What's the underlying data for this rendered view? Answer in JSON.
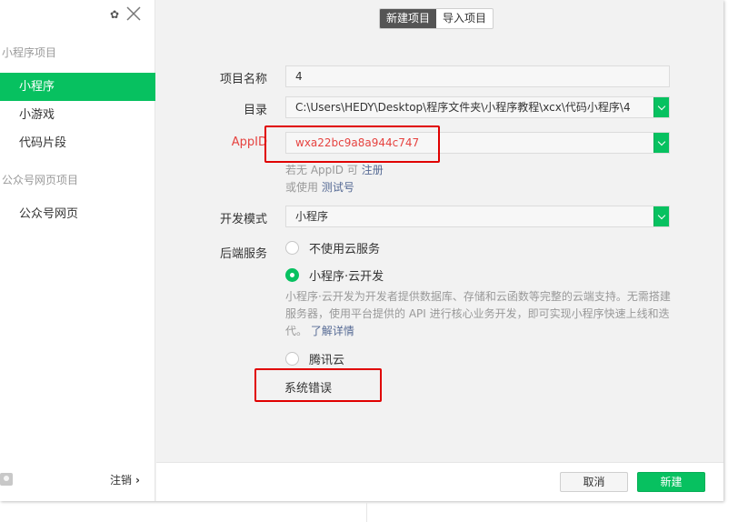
{
  "sidebar": {
    "settings_icon": "gear-icon",
    "close_icon": "close-icon",
    "section_mini": "小程序项目",
    "items_mini": [
      {
        "label": "小程序",
        "active": true
      },
      {
        "label": "小游戏",
        "active": false
      },
      {
        "label": "代码片段",
        "active": false
      }
    ],
    "section_public": "公众号网页项目",
    "items_public": [
      {
        "label": "公众号网页",
        "active": false
      }
    ],
    "logout_label": "注销",
    "logout_chevron": "›"
  },
  "tabs": [
    {
      "label": "新建项目",
      "active": true
    },
    {
      "label": "导入项目",
      "active": false
    }
  ],
  "form": {
    "name_label": "项目名称",
    "name_value": "4",
    "dir_label": "目录",
    "dir_value": "C:\\Users\\HEDY\\Desktop\\程序文件夹\\小程序教程\\xcx\\代码小程序\\4",
    "appid_label": "AppID",
    "appid_value": "wxa22bc9a8a944c747",
    "appid_hint_prefix": "若无 AppID 可",
    "appid_hint_link": "注册",
    "appid_hint2_prefix": "或使用",
    "appid_hint2_link": "测试号",
    "mode_label": "开发模式",
    "mode_value": "小程序",
    "backend_label": "后端服务",
    "backend_options": [
      {
        "label": "不使用云服务",
        "selected": false
      },
      {
        "label": "小程序·云开发",
        "selected": true
      },
      {
        "label": "腾讯云",
        "selected": false
      }
    ],
    "cloud_desc": "小程序·云开发为开发者提供数据库、存储和云函数等完整的云端支持。无需搭建服务器，使用平台提供的 API 进行核心业务开发，即可实现小程序快速上线和迭代。",
    "cloud_desc_link": "了解详情",
    "error_text": "系统错误"
  },
  "footer": {
    "cancel_label": "取消",
    "create_label": "新建"
  },
  "colors": {
    "accent": "#07c160",
    "error_red": "#e64340",
    "highlight_box": "#e00000"
  }
}
